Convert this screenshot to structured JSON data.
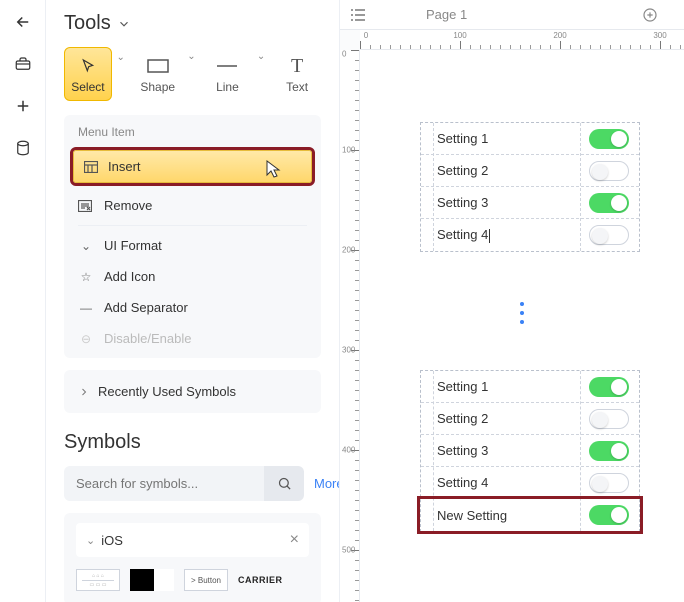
{
  "rail": {
    "icons": [
      "back",
      "toolbox",
      "plus",
      "database"
    ]
  },
  "panel": {
    "title": "Tools",
    "tools": [
      {
        "label": "Select",
        "selected": true
      },
      {
        "label": "Shape"
      },
      {
        "label": "Line"
      },
      {
        "label": "Text"
      }
    ],
    "menu": {
      "header": "Menu Item",
      "insert": "Insert",
      "remove": "Remove",
      "uiformat": "UI Format",
      "addicon": "Add Icon",
      "addsep": "Add Separator",
      "disable": "Disable/Enable"
    },
    "recent": "Recently Used Symbols",
    "symbols": {
      "title": "Symbols",
      "search_placeholder": "Search for symbols...",
      "more": "More",
      "lib": "iOS",
      "btn_label": "> Button",
      "carrier": "CARRIER"
    }
  },
  "canvas": {
    "page_tab": "Page 1",
    "ruler_h": [
      "0",
      "100",
      "200",
      "300"
    ],
    "ruler_v": [
      "0",
      "100",
      "200",
      "300",
      "400",
      "500"
    ],
    "mock1": {
      "rows": [
        {
          "label": "Setting 1",
          "on": true
        },
        {
          "label": "Setting 2",
          "on": false
        },
        {
          "label": "Setting 3",
          "on": true
        },
        {
          "label": "Setting 4",
          "on": false,
          "cursor": true
        }
      ]
    },
    "mock2": {
      "rows": [
        {
          "label": "Setting 1",
          "on": true
        },
        {
          "label": "Setting 2",
          "on": false
        },
        {
          "label": "Setting 3",
          "on": true
        },
        {
          "label": "Setting 4",
          "on": false
        },
        {
          "label": "New Setting",
          "on": true,
          "highlight": true
        }
      ]
    }
  }
}
